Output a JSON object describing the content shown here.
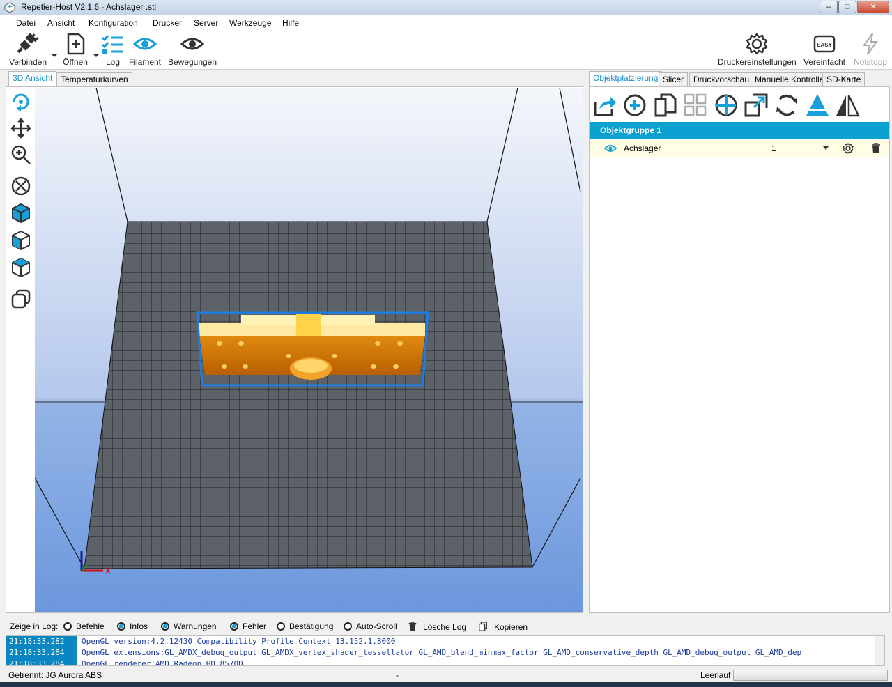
{
  "window": {
    "title": "Repetier-Host V2.1.6 - Achslager .stl",
    "min": "–",
    "max": "□",
    "close": "✕"
  },
  "menu": [
    "Datei",
    "Ansicht",
    "Konfiguration",
    "Drucker",
    "Server",
    "Werkzeuge",
    "Hilfe"
  ],
  "toolbar": {
    "connect": "Verbinden",
    "open": "Öffnen",
    "log": "Log",
    "filament": "Filament",
    "movements": "Bewegungen",
    "printer_settings": "Druckereinstellungen",
    "simplified": "Vereinfacht",
    "easy_badge": "EASY",
    "emergency_stop": "Notstopp"
  },
  "left_tabs": [
    "3D Ansicht",
    "Temperaturkurven"
  ],
  "right_tabs": [
    "Objektplatzierung",
    "Slicer",
    "Druckvorschau",
    "Manuelle Kontrolle",
    "SD-Karte"
  ],
  "object_group": {
    "header": "Objektgruppe 1",
    "objects": [
      {
        "name": "Achslager",
        "copies": "1"
      }
    ]
  },
  "log_controls": {
    "label": "Zeige in Log:",
    "options": [
      {
        "label": "Befehle",
        "checked": false
      },
      {
        "label": "Infos",
        "checked": true
      },
      {
        "label": "Warnungen",
        "checked": true
      },
      {
        "label": "Fehler",
        "checked": true
      },
      {
        "label": "Bestätigung",
        "checked": false
      },
      {
        "label": "Auto-Scroll",
        "checked": false
      }
    ],
    "clear": "Lösche Log",
    "copy": "Kopieren"
  },
  "log": [
    {
      "time": "21:18:33.282",
      "msg": "OpenGL version:4.2.12430 Compatibility Profile Context 13.152.1.8000"
    },
    {
      "time": "21:18:33.284",
      "msg": "OpenGL extensions:GL_AMDX_debug_output GL_AMDX_vertex_shader_tessellator GL_AMD_blend_minmax_factor GL_AMD_conservative_depth GL_AMD_debug_output GL_AMD_dep"
    },
    {
      "time": "21:18:33.284",
      "msg": "OpenGL renderer:AMD Radeon HD 8570D"
    }
  ],
  "status": {
    "connection": "Getrennt: JG Aurora ABS",
    "middle": "-",
    "state": "Leerlauf"
  },
  "colors": {
    "accent": "#0aa0cf",
    "bed": "#5a5f66",
    "object": "#d98a00"
  }
}
